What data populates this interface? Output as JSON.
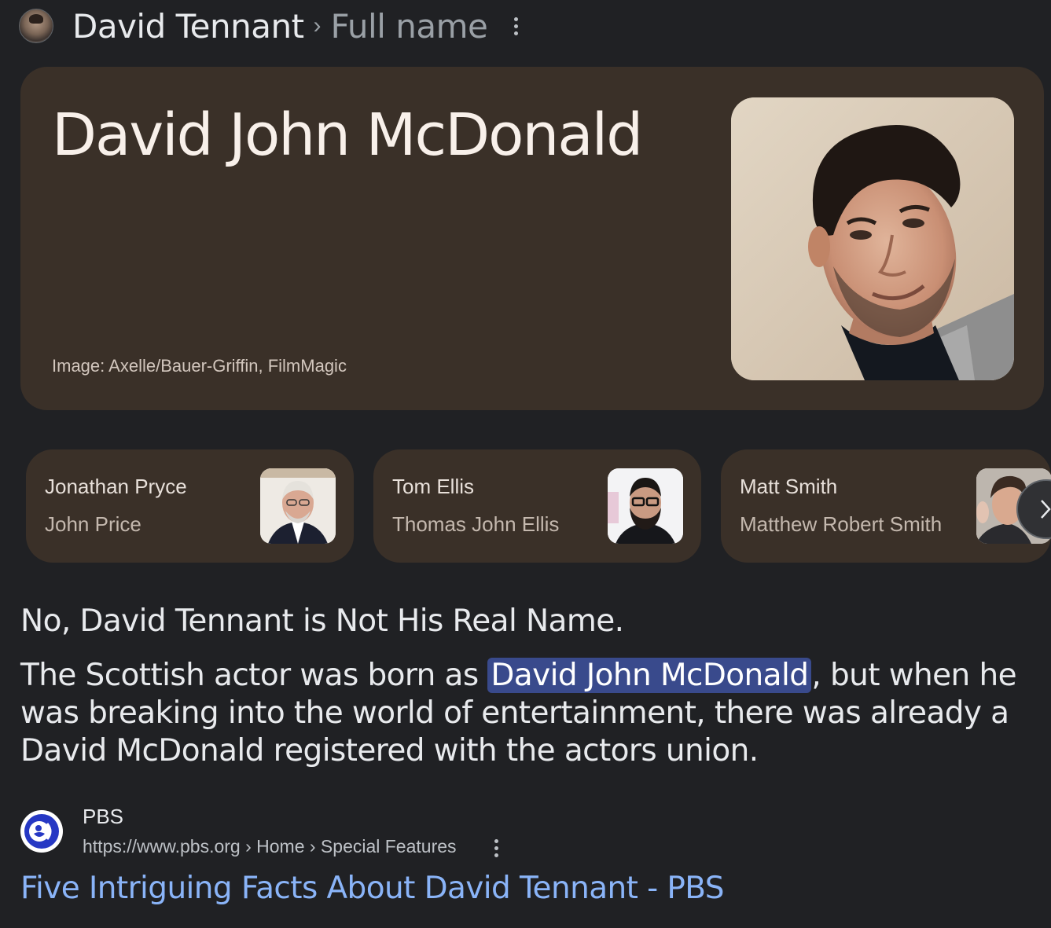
{
  "header": {
    "title": "David Tennant",
    "separator": "›",
    "subtitle": "Full name",
    "more_icon": "vertical-dots-icon"
  },
  "answer": {
    "full_name": "David John McDonald",
    "image_credit": "Image: Axelle/Bauer-Griffin, FilmMagic"
  },
  "related": [
    {
      "name": "Jonathan Pryce",
      "real_name": "John Price"
    },
    {
      "name": "Tom Ellis",
      "real_name": "Thomas John Ellis"
    },
    {
      "name": "Matt Smith",
      "real_name": "Matthew Robert Smith"
    }
  ],
  "related_next_icon": "chevron-right-icon",
  "snippet": {
    "heading": "No, David Tennant is Not His Real Name.",
    "text_before": "The Scottish actor was born as ",
    "highlight": "David John McDonald",
    "text_after": ", but when he was breaking into the world of entertainment, there was already a David McDonald registered with the actors union."
  },
  "source": {
    "name": "PBS",
    "url": "https://www.pbs.org › Home › Special Features",
    "title": "Five Intriguing Facts About David Tennant - PBS"
  },
  "colors": {
    "background": "#202124",
    "card": "#3a3028",
    "highlight": "#394a8c",
    "link": "#8ab4f8",
    "pbs_blue": "#2638c4"
  }
}
